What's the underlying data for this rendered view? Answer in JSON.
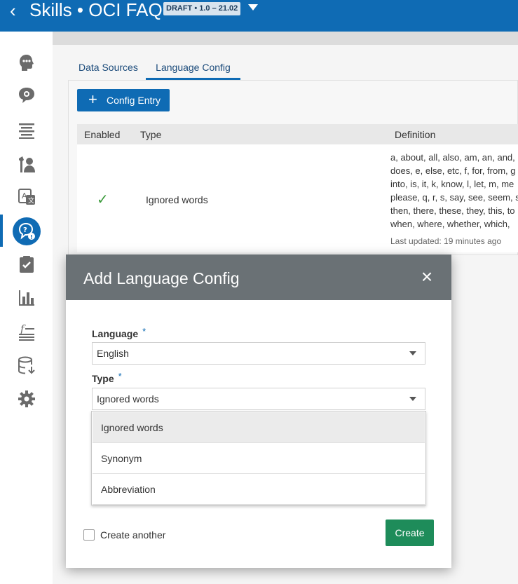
{
  "header": {
    "back_glyph": "‹",
    "title": "Skills • OCI FAQ",
    "version_badge": "DRAFT • 1.0 – 21.02"
  },
  "sidebar": {
    "items": [
      {
        "icon": "bot-head-icon"
      },
      {
        "icon": "chat-bubble-gear-icon"
      },
      {
        "icon": "list-lines-icon"
      },
      {
        "icon": "tools-person-icon"
      },
      {
        "icon": "translate-icon"
      },
      {
        "icon": "question-bubble-icon",
        "selected": true
      },
      {
        "icon": "clipboard-check-icon"
      },
      {
        "icon": "bar-chart-icon"
      },
      {
        "icon": "function-icon"
      },
      {
        "icon": "database-download-icon"
      },
      {
        "icon": "gear-icon"
      }
    ]
  },
  "tabs": [
    {
      "label": "Data Sources"
    },
    {
      "label": "Language Config",
      "active": true
    }
  ],
  "toolbar": {
    "add_label": "Config Entry",
    "plus_glyph": "+"
  },
  "table": {
    "columns": [
      "Enabled",
      "Type",
      "Definition"
    ],
    "rows": [
      {
        "enabled": true,
        "check_glyph": "✓",
        "type": "Ignored words",
        "definition_lines": [
          "a, about, all, also, am, an, and,",
          "does, e, else, etc, f, for, from, g",
          "into, is, it, k, know, l, let, m, me",
          "please, q, r, s, say, see, seem, s",
          "then, there, these, they, this, to",
          "when, where, whether, which,"
        ],
        "last_updated": "Last updated: 19 minutes ago"
      }
    ]
  },
  "dialog": {
    "title": "Add Language Config",
    "close_glyph": "×",
    "language": {
      "label": "Language",
      "required": "*",
      "value": "English"
    },
    "type": {
      "label": "Type",
      "required": "*",
      "value": "Ignored words"
    },
    "type_options": [
      {
        "label": "Ignored words",
        "highlighted": true
      },
      {
        "label": "Synonym"
      },
      {
        "label": "Abbreviation"
      }
    ],
    "create_another_label": "Create another",
    "create_another_checked": false,
    "create_label": "Create"
  },
  "colors": {
    "brand_blue": "#0f6bb4",
    "dialog_header": "#6a7175",
    "create_green": "#1e8c5a",
    "check_green": "#3a9a3a"
  }
}
